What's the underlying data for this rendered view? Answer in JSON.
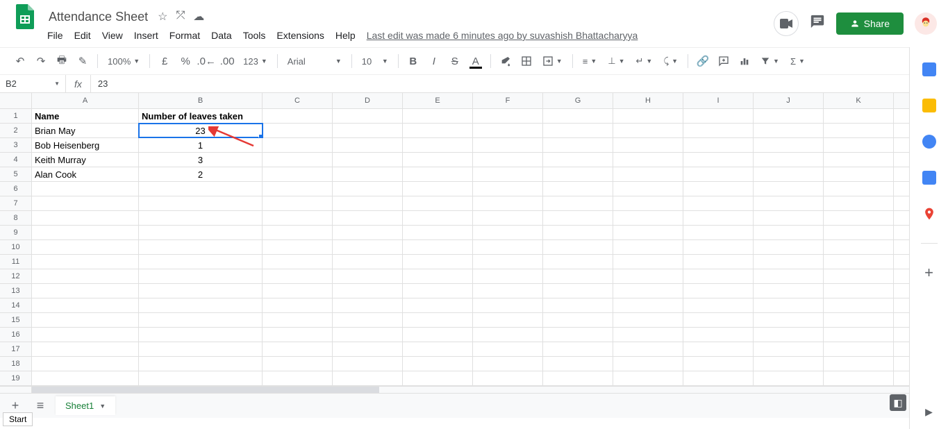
{
  "doc_title": "Attendance Sheet",
  "menu": {
    "file": "File",
    "edit": "Edit",
    "view": "View",
    "insert": "Insert",
    "format": "Format",
    "data": "Data",
    "tools": "Tools",
    "extensions": "Extensions",
    "help": "Help"
  },
  "last_edit": "Last edit was made 6 minutes ago by suvashish Bhattacharyya",
  "share_label": "Share",
  "toolbar": {
    "zoom": "100%",
    "font": "Arial",
    "font_size": "10",
    "currency": "£",
    "percent": "%",
    "fmt123": "123"
  },
  "name_box": "B2",
  "formula_value": "23",
  "columns": [
    "A",
    "B",
    "C",
    "D",
    "E",
    "F",
    "G",
    "H",
    "I",
    "J",
    "K"
  ],
  "headers": {
    "A": "Name",
    "B": "Number of leaves taken"
  },
  "rows": [
    {
      "n": "1",
      "A": "Name",
      "B": "Number of leaves taken",
      "bold": true
    },
    {
      "n": "2",
      "A": "Brian May",
      "B": "23",
      "selected_col": "B"
    },
    {
      "n": "3",
      "A": "Bob Heisenberg",
      "B": "1"
    },
    {
      "n": "4",
      "A": "Keith  Murray",
      "B": "3"
    },
    {
      "n": "5",
      "A": "Alan Cook",
      "B": "2"
    },
    {
      "n": "6"
    },
    {
      "n": "7"
    },
    {
      "n": "8"
    },
    {
      "n": "9"
    },
    {
      "n": "10"
    },
    {
      "n": "11"
    },
    {
      "n": "12"
    },
    {
      "n": "13"
    },
    {
      "n": "14"
    },
    {
      "n": "15"
    },
    {
      "n": "16"
    },
    {
      "n": "17"
    },
    {
      "n": "18"
    },
    {
      "n": "19"
    }
  ],
  "sheet_tab": "Sheet1",
  "start_label": "Start"
}
